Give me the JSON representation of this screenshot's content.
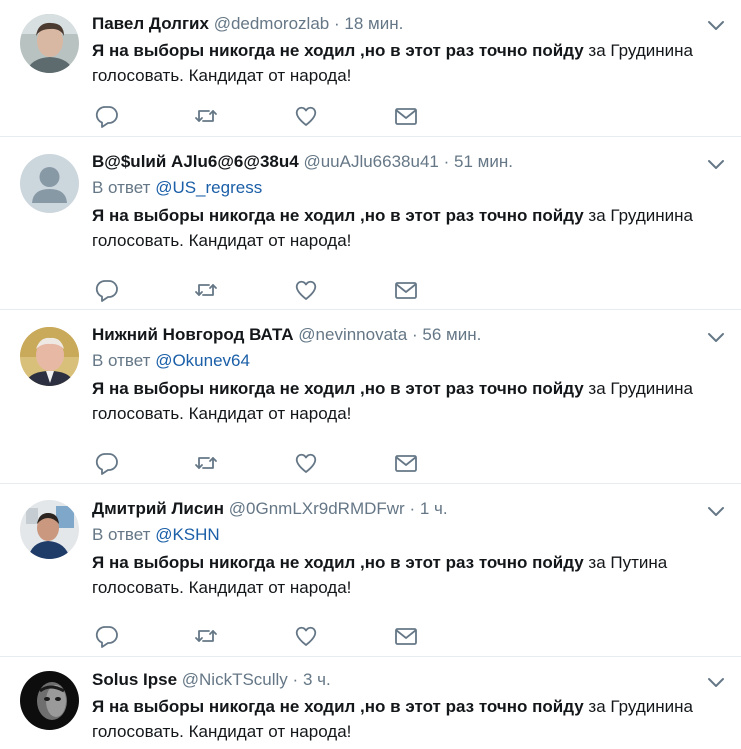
{
  "tweets": [
    {
      "fullname": "Павел Долгих",
      "username": "@dedmorozlab",
      "separator": "·",
      "time": "18 мин.",
      "text_bold": "Я на выборы никогда не ходил ,но в этот раз точно пойду",
      "text_line1_rest": " за Грудинина",
      "text_line2": "голосовать. Кандидат от народа!"
    },
    {
      "fullname": "В@$ulий AJlu6@6@38u4",
      "username": "@uuAJlu6638u41",
      "separator": "·",
      "time": "51 мин.",
      "reply_prefix": "В ответ",
      "reply_mention": "@US_regress",
      "text_bold": "Я на выборы никогда не ходил ,но в этот раз точно пойду",
      "text_line1_rest": " за Грудинина",
      "text_line2": "голосовать. Кандидат от народа!"
    },
    {
      "fullname": "Нижний Новгород ВАТА",
      "username": "@nevinnovata",
      "separator": "·",
      "time": "56 мин.",
      "reply_prefix": "В ответ",
      "reply_mention": "@Okunev64",
      "text_bold": "Я на выборы никогда не ходил ,но в этот раз точно пойду",
      "text_line1_rest": " за Грудинина",
      "text_line2": "голосовать. Кандидат от народа!"
    },
    {
      "fullname": "Дмитрий Лисин",
      "username": "@0GnmLXr9dRMDFwr",
      "separator": "·",
      "time": "1 ч.",
      "reply_prefix": "В ответ",
      "reply_mention": "@KSHN",
      "text_bold": "Я на выборы никогда не ходил ,но в этот раз точно пойду",
      "text_line1_rest": " за Путина",
      "text_line2": "голосовать. Кандидат от народа!"
    },
    {
      "fullname": "Solus Ipse",
      "username": "@NickTScully",
      "separator": "·",
      "time": "3 ч.",
      "text_bold": "Я на выборы никогда не ходил ,но в этот раз точно пойду",
      "text_line1_rest": " за Грудинина",
      "text_line2": "голосовать. Кандидат от народа!"
    }
  ],
  "icons": {
    "reply": "reply-icon",
    "retweet": "retweet-icon",
    "like": "like-icon",
    "direct_message": "direct-message-icon",
    "more": "chevron-down-icon"
  },
  "colors": {
    "icon_gray": "#657786",
    "mention_blue": "#1b5fa8",
    "divider": "#e6ecf0",
    "default_avatar_bg": "#ccd6dd"
  }
}
